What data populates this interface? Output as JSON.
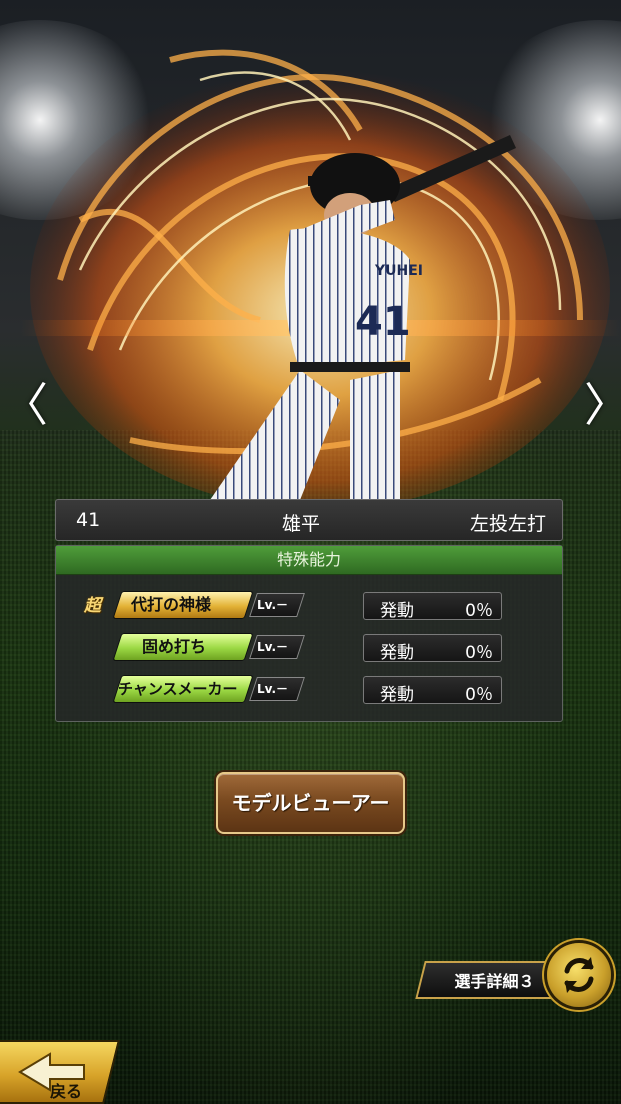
{
  "player": {
    "number": "41",
    "name": "雄平",
    "throw_bat": "左投左打",
    "jersey_name": "YUHEI",
    "jersey_number": "41"
  },
  "abilities": {
    "header": "特殊能力",
    "items": [
      {
        "rank": "超",
        "name": "代打の神様",
        "level": "Lv.－",
        "status_label": "発動",
        "percent": "0％",
        "tier": "gold"
      },
      {
        "rank": "",
        "name": "固め打ち",
        "level": "Lv.－",
        "status_label": "発動",
        "percent": "0％",
        "tier": "green"
      },
      {
        "rank": "",
        "name": "チャンスメーカー",
        "level": "Lv.－",
        "status_label": "発動",
        "percent": "0％",
        "tier": "green"
      }
    ]
  },
  "buttons": {
    "model_viewer": "モデルビューアー",
    "player_detail": "選手詳細３",
    "back": "戻る"
  },
  "nav": {
    "prev": "〈",
    "next": "〉"
  },
  "colors": {
    "accent_green": "#3f8a2e",
    "gold": "#d8a42a",
    "fire": "#ff8a1c"
  }
}
